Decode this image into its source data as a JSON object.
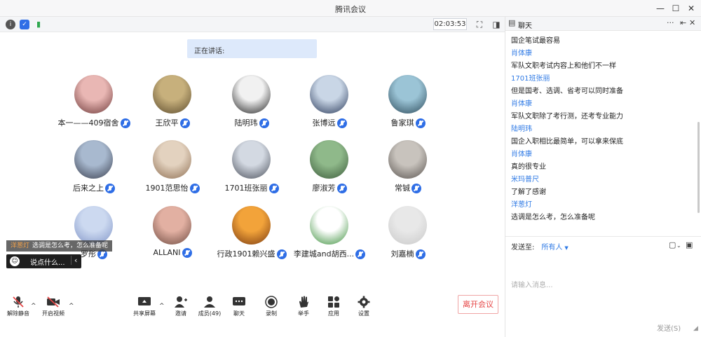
{
  "window": {
    "title": "腾讯会议"
  },
  "infobar": {
    "timer": "02:03:53"
  },
  "speaking": {
    "label": "正在讲话:"
  },
  "participants": [
    {
      "name": "本一——409宿舍",
      "color1": "#e9b7b4",
      "color2": "#6e3a3a"
    },
    {
      "name": "王欣平",
      "color1": "#c7b07c",
      "color2": "#5b4a2c"
    },
    {
      "name": "陆明玮",
      "color1": "#f1f1f1",
      "color2": "#222222"
    },
    {
      "name": "张博远",
      "color1": "#c9d6e6",
      "color2": "#2a3a5a"
    },
    {
      "name": "鲁家琪",
      "color1": "#9bc4d6",
      "color2": "#2c4a5a"
    },
    {
      "name": "后来之上",
      "color1": "#a8b9cf",
      "color2": "#3a3f4f"
    },
    {
      "name": "1901范思怡",
      "color1": "#e3d2bf",
      "color2": "#8d6e52"
    },
    {
      "name": "1701班张丽",
      "color1": "#d3d9e2",
      "color2": "#4a4f5a"
    },
    {
      "name": "廖淑芳",
      "color1": "#8fb98a",
      "color2": "#3b5a3a"
    },
    {
      "name": "常铖",
      "color1": "#c8c3bd",
      "color2": "#5a5450"
    },
    {
      "name": "罗彤",
      "color1": "#ccd9f0",
      "color2": "#7f93c6"
    },
    {
      "name": "ALLANI",
      "color1": "#e2b0a2",
      "color2": "#6e4a40"
    },
    {
      "name": "行政1901赖兴盛",
      "color1": "#f2a33a",
      "color2": "#7a3a10"
    },
    {
      "name": "李建城and胡西...",
      "color1": "#ffffff",
      "color2": "#3a8f3a"
    },
    {
      "name": "刘嘉楠",
      "color1": "#e8e8e8",
      "color2": "#c9c9c9"
    }
  ],
  "overlay": {
    "toast_sender": "洋葱灯",
    "toast_text": "选调是怎么考，怎么准备呢",
    "quick_input": "说点什么..."
  },
  "toolbar": {
    "mute": "解除静音",
    "video": "开启视频",
    "share": "共享屏幕",
    "invite": "邀请",
    "members": "成员(49)",
    "chat": "聊天",
    "record": "录制",
    "raise": "举手",
    "apps": "应用",
    "settings": "设置",
    "leave": "离开会议"
  },
  "chat": {
    "title": "聊天",
    "messages": [
      {
        "kind": "body",
        "text": "国企笔试最容易"
      },
      {
        "kind": "sender",
        "text": "肖体康"
      },
      {
        "kind": "body",
        "text": "军队文职考试内容上和他们不一样"
      },
      {
        "kind": "sender",
        "text": "1701班张丽"
      },
      {
        "kind": "body",
        "text": "但是国考、选调、省考可以同时准备"
      },
      {
        "kind": "sender",
        "text": "肖体康"
      },
      {
        "kind": "body",
        "text": "军队文职除了考行测，还考专业能力"
      },
      {
        "kind": "sender",
        "text": "陆明玮"
      },
      {
        "kind": "body",
        "text": "国企入职相比最简单，可以拿来保底"
      },
      {
        "kind": "sender",
        "text": "肖体康"
      },
      {
        "kind": "body",
        "text": "真的很专业"
      },
      {
        "kind": "sender",
        "text": "米玛普尺"
      },
      {
        "kind": "body",
        "text": "了解了感谢"
      },
      {
        "kind": "sender",
        "text": "洋葱灯"
      },
      {
        "kind": "body",
        "text": "选调是怎么考，怎么准备呢"
      }
    ],
    "send_to_label": "发送至:",
    "send_to_value": "所有人",
    "input_placeholder": "请输入消息...",
    "send_button": "发送(S)"
  }
}
